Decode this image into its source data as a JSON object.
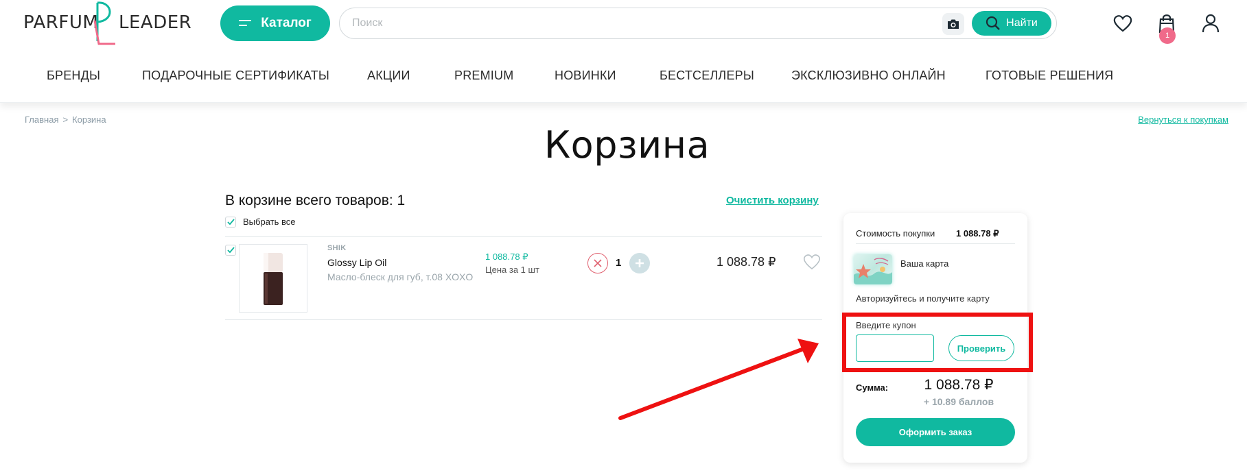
{
  "brand": {
    "logo_left": "PARFUM",
    "logo_right": "LEADER",
    "logo_monogram": "PL",
    "accent_color": "#10b9a0",
    "logo_pink": "#f06a8a"
  },
  "header": {
    "catalog_label": "Каталог",
    "search_placeholder": "Поиск",
    "search_value": "",
    "find_label": "Найти",
    "cart_count": "1",
    "icons": [
      "menu-icon",
      "camera-icon",
      "search-icon",
      "heart-icon",
      "shopping-bag-icon",
      "user-icon"
    ]
  },
  "nav": {
    "items": [
      {
        "label": "БРЕНДЫ"
      },
      {
        "label": "ПОДАРОЧНЫЕ СЕРТИФИКАТЫ"
      },
      {
        "label": "АКЦИИ"
      },
      {
        "label": "PREMIUM"
      },
      {
        "label": "НОВИНКИ"
      },
      {
        "label": "БЕСТСЕЛЛЕРЫ"
      },
      {
        "label": "ЭКСКЛЮЗИВНО ОНЛАЙН"
      },
      {
        "label": "ГОТОВЫЕ РЕШЕНИЯ"
      }
    ]
  },
  "breadcrumb": {
    "home": "Главная",
    "separator": ">",
    "current": "Корзина"
  },
  "back_link": "Вернуться к покупкам",
  "page_title": "Корзина",
  "cart": {
    "count_text": "В корзине всего товаров: 1",
    "clear_label": "Очистить корзину",
    "select_all_label": "Выбрать все",
    "select_all_checked": true,
    "items": [
      {
        "checked": true,
        "brand": "SHIK",
        "name": "Glossy Lip Oil",
        "description": "Масло-блеск для губ, т.08 XOXO",
        "unit_price": "1 088.78 ₽",
        "unit_note": "Цена за 1 шт",
        "quantity": "1",
        "total": "1 088.78 ₽"
      }
    ]
  },
  "summary": {
    "cost_label": "Стоимость покупки",
    "cost_value": "1 088.78 ₽",
    "card_label": "Ваша карта",
    "auth_text": "Авторизуйтесь и получите карту",
    "coupon_label": "Введите купон",
    "coupon_value": "",
    "check_label": "Проверить",
    "sum_label": "Сумма:",
    "sum_value": "1 088.78 ₽",
    "bonus_text": "+ 10.89 баллов",
    "order_label": "Оформить заказ"
  },
  "annotation": {
    "box_color": "#ee1111",
    "arrow_color": "#ee1111"
  }
}
